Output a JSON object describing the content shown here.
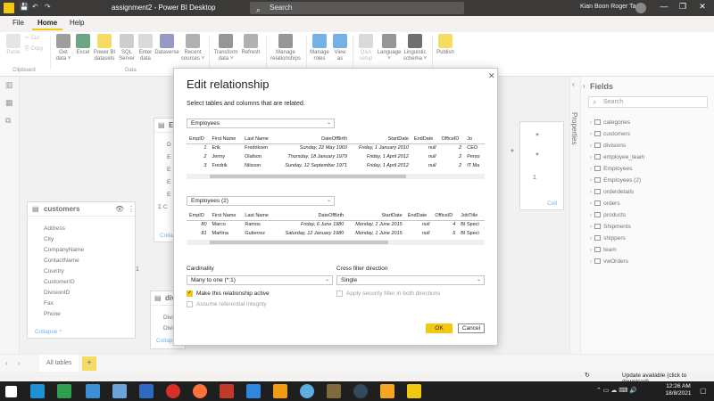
{
  "window": {
    "title": "assignment2 - Power BI Desktop",
    "search_placeholder": "Search",
    "user": "Kian Boon Roger Tan"
  },
  "ribbon_tabs": [
    "File",
    "Home",
    "Help"
  ],
  "ribbon": {
    "clipboard": {
      "paste": "Paste",
      "cut": "Cut",
      "copy": "Copy",
      "group": "Clipboard"
    },
    "data": {
      "get_data": "Get\ndata ˅",
      "excel": "Excel",
      "pbi_datasets": "Power BI\ndatasets",
      "sql_server": "SQL\nServer",
      "enter_data": "Enter\ndata",
      "dataverse": "Dataverse",
      "recent_sources": "Recent\nsources ˅",
      "group": "Data"
    },
    "transform_data": "Transform\ndata ˅",
    "refresh": "Refresh",
    "manage_relationships": "Manage\nrelationships",
    "manage_roles": "Manage\nroles",
    "view_as": "View\nas",
    "qa_setup": "Q&A\nsetup",
    "language": "Language\n˅",
    "linguistic_schema": "Linguistic\nschema ˅",
    "publish": "Publish"
  },
  "canvas": {
    "customers_card": {
      "title": "customers",
      "fields": [
        "Address",
        "City",
        "CompanyName",
        "ContactName",
        "Country",
        "CustomerID",
        "DivisionID",
        "Fax",
        "Phone"
      ],
      "collapse": "Collapse ^"
    },
    "div_card": {
      "title": "div",
      "fields": [
        "Divi",
        "Divi"
      ],
      "collapse": "Collaps"
    },
    "e_card": {
      "title": "E",
      "fields": [
        "D",
        "E",
        "E",
        "E",
        "E",
        "Σ C"
      ],
      "collapse": "Collap"
    },
    "right_card_collapse": "Coll",
    "rel_labels": [
      "*",
      "1",
      "*",
      "*",
      "1"
    ]
  },
  "properties_label": "Properties",
  "fields_pane": {
    "title": "Fields",
    "search_placeholder": "Search",
    "items": [
      "categories",
      "customers",
      "divisions",
      "employee_team",
      "Employees",
      "Employees (2)",
      "orderdetails",
      "orders",
      "products",
      "Shipments",
      "shippers",
      "team",
      "vwOrders"
    ]
  },
  "dialog": {
    "title": "Edit relationship",
    "subtitle": "Select tables and columns that are related.",
    "table1_select": "Employees",
    "table1": {
      "headers": [
        "EmpID",
        "First Name",
        "Last Name",
        "DateOfBirth",
        "StartDate",
        "EndDate",
        "OfficeID",
        "Jo"
      ],
      "rows": [
        [
          "1",
          "Erik",
          "Fredriksen",
          "Sunday, 22 May 1960",
          "Friday, 1 January 2010",
          "null",
          "2",
          "CEO"
        ],
        [
          "2",
          "Jenny",
          "Olafson",
          "Thursday, 18 January 1979",
          "Friday, 1 April 2012",
          "null",
          "2",
          "Perso"
        ],
        [
          "3",
          "Fredrik",
          "Nilsson",
          "Sunday, 12 September 1971",
          "Friday, 1 April 2012",
          "null",
          "2",
          "IT Ma"
        ]
      ]
    },
    "table2_select": "Employees (2)",
    "table2": {
      "headers": [
        "EmpID",
        "First Name",
        "Last Name",
        "DateOfBirth",
        "StartDate",
        "EndDate",
        "OfficeID",
        "JobTitle"
      ],
      "rows": [
        [
          "80",
          "Marco",
          "Ramos",
          "Friday, 6 June 1980",
          "Monday, 1 June 2015",
          "null",
          "4",
          "BI Speci"
        ],
        [
          "81",
          "Martina",
          "Gutierrez",
          "Saturday, 12 January 1980",
          "Monday, 1 June 2015",
          "null",
          "5",
          "BI Speci"
        ]
      ]
    },
    "cardinality_label": "Cardinality",
    "cardinality_value": "Many to one (*:1)",
    "cross_filter_label": "Cross filter direction",
    "cross_filter_value": "Single",
    "make_active": "Make this relationship active",
    "security_filter": "Apply security filter in both directions",
    "assume_integrity": "Assume referential integrity",
    "ok": "OK",
    "cancel": "Cancel"
  },
  "bottom": {
    "tab_all_tables": "All tables",
    "add": "+"
  },
  "status": {
    "update": "Update available (click to download)"
  },
  "taskbar": {
    "time": "12:26 AM",
    "date": "18/8/2021"
  },
  "colors": {
    "accent": "#f2c811",
    "titlebar": "#3b3a39"
  }
}
